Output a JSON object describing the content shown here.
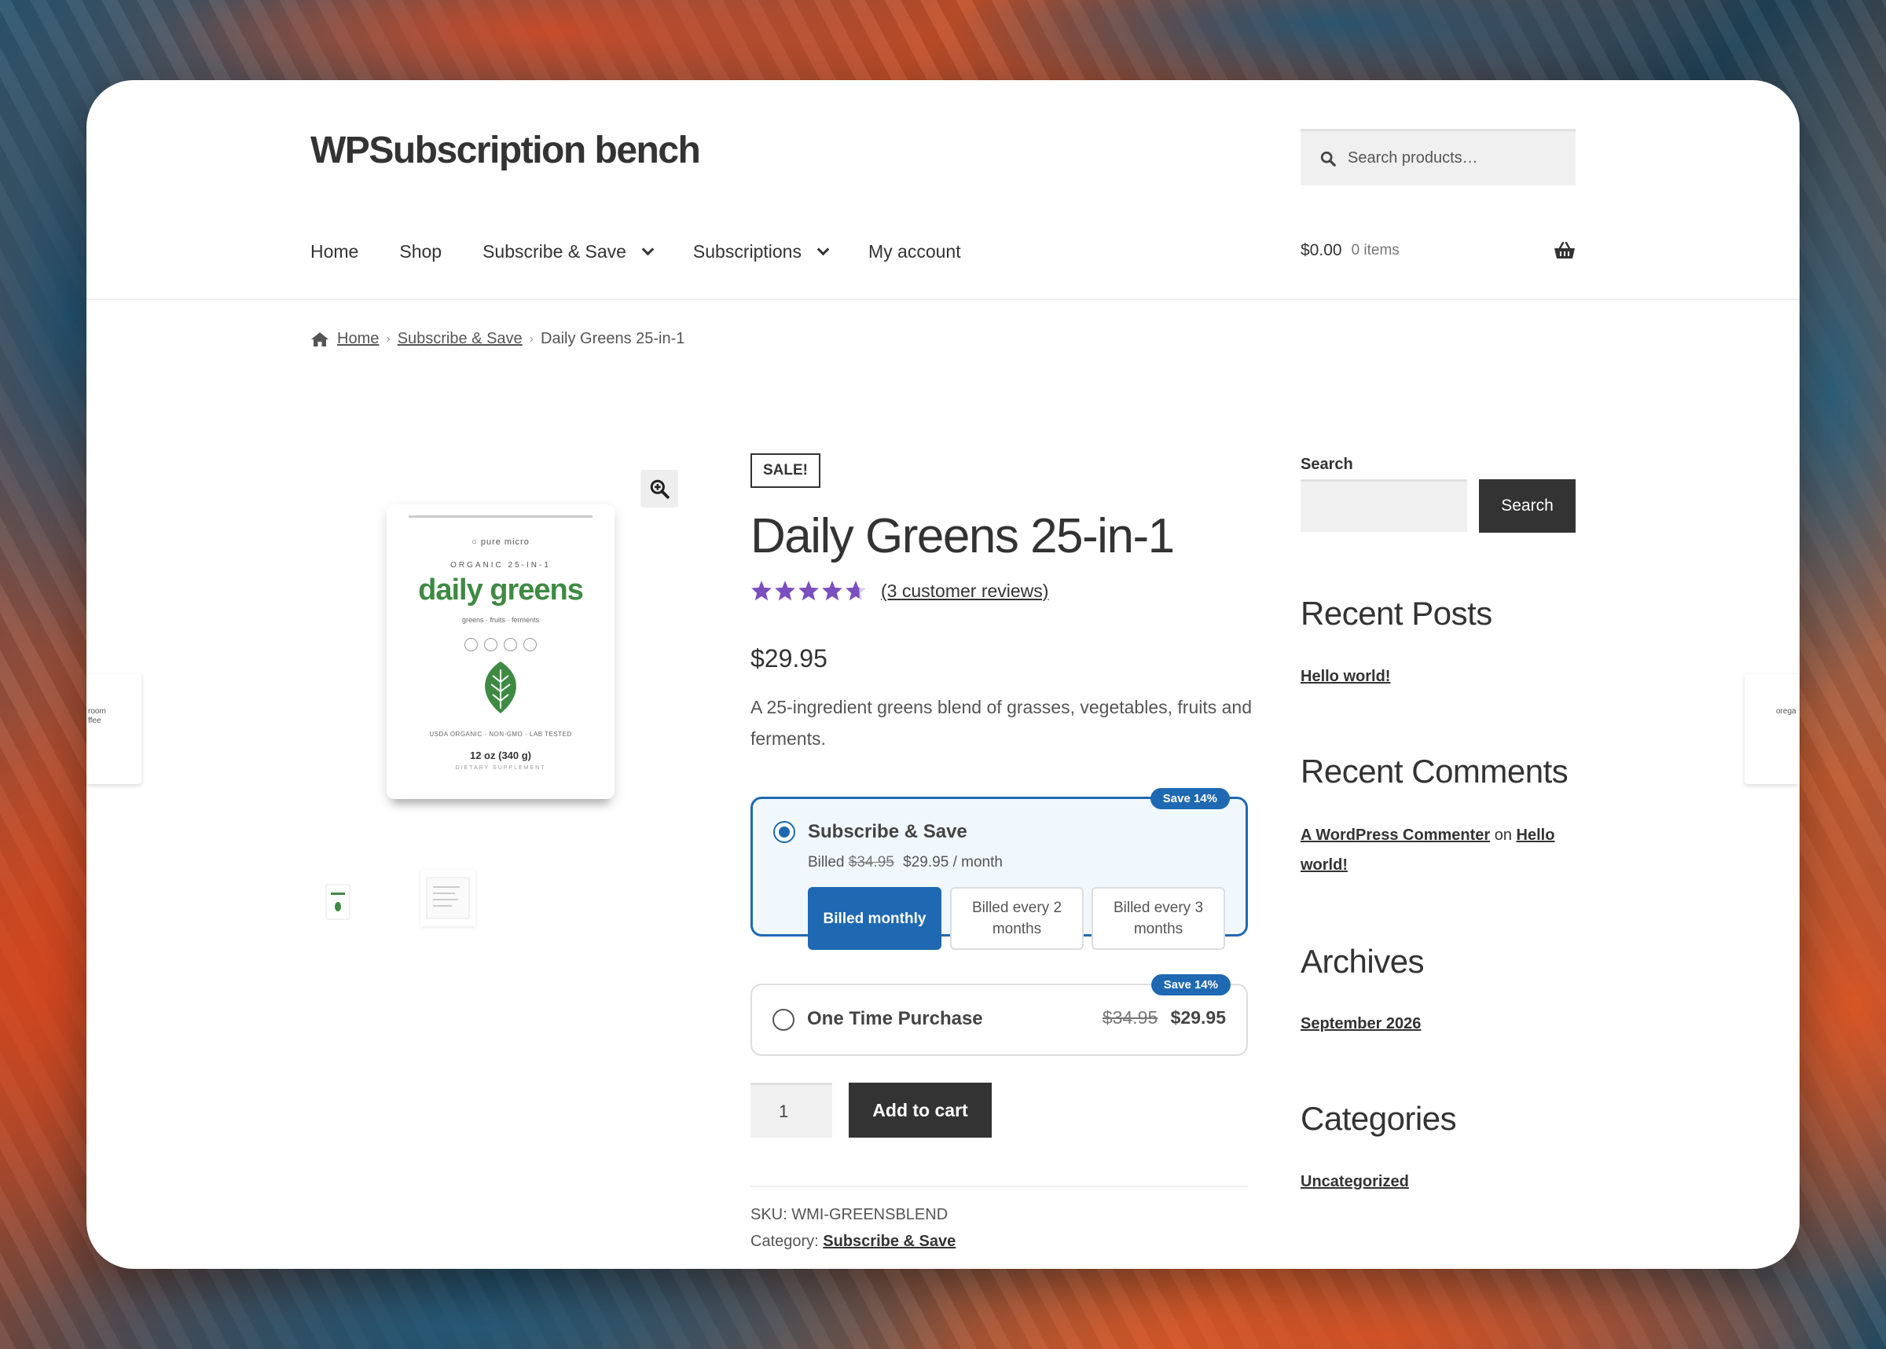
{
  "site": {
    "title": "WPSubscription bench",
    "search_placeholder": "Search products…"
  },
  "nav": {
    "home": "Home",
    "shop": "Shop",
    "subscribe_save": "Subscribe & Save",
    "subscriptions": "Subscriptions",
    "my_account": "My account"
  },
  "cart": {
    "amount": "$0.00",
    "count": "0 items"
  },
  "breadcrumb": {
    "home": "Home",
    "category": "Subscribe & Save",
    "current": "Daily Greens 25-in-1"
  },
  "product_image": {
    "brand": "○ pure micro",
    "subtitle": "ORGANIC 25-IN-1",
    "name": "daily greens",
    "tagline": "greens · fruits · ferments",
    "certs": "USDA ORGANIC  ·  NON-GMO  ·  LAB TESTED",
    "size": "12 oz (340 g)",
    "type": "DIETARY SUPPLEMENT"
  },
  "product": {
    "badge": "SALE!",
    "title": "Daily Greens 25-in-1",
    "rating": 4.67,
    "reviews": "(3 customer reviews)",
    "price": "$29.95",
    "description": "A 25-ingredient greens blend of grasses, vegetables, fruits and ferments."
  },
  "purchase_options": {
    "subscribe": {
      "title": "Subscribe & Save",
      "badge": "Save 14%",
      "billed_prefix": "Billed",
      "old_price": "$34.95",
      "new_price": "$29.95 / month",
      "frequencies": [
        "Billed monthly",
        "Billed every 2 months",
        "Billed every 3 months"
      ],
      "selected": true
    },
    "one_time": {
      "title": "One Time Purchase",
      "badge": "Save 14%",
      "old_price": "$34.95",
      "new_price": "$29.95",
      "selected": false
    }
  },
  "quantity": "1",
  "add_to_cart": "Add to cart",
  "meta": {
    "sku_label": "SKU:",
    "sku": "WMI-GREENSBLEND",
    "category_label": "Category:",
    "category": "Subscribe & Save"
  },
  "sidebar": {
    "search_label": "Search",
    "search_button": "Search",
    "recent_posts_title": "Recent Posts",
    "recent_post": "Hello world!",
    "recent_comments_title": "Recent Comments",
    "comment_author": "A WordPress Commenter",
    "comment_on": "on",
    "comment_post": "Hello world!",
    "archives_title": "Archives",
    "archive": "September 2026",
    "categories_title": "Categories",
    "category": "Uncategorized"
  },
  "side_cards": {
    "left": "room ffee",
    "right": "orega"
  },
  "colors": {
    "accent": "#1f69b3",
    "star": "#7b4fbf",
    "brand_green": "#3e8a43",
    "dark_button": "#333333"
  }
}
